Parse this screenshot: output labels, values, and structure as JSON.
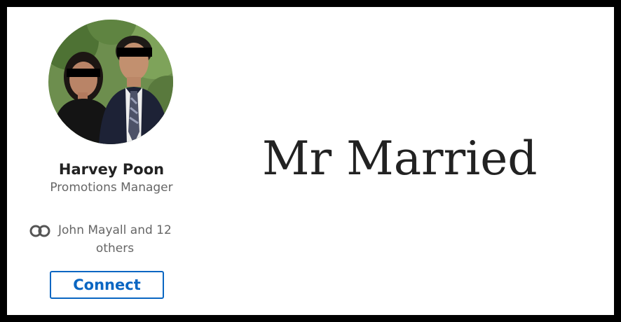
{
  "profile": {
    "name": "Harvey Poon",
    "title": "Promotions Manager",
    "mutual_line1": "John Mayall and 12",
    "mutual_line2": "others",
    "connect_label": "Connect",
    "mutual_icon": "linked-circles-icon"
  },
  "headline": "Mr Married",
  "colors": {
    "accent": "#0a66c2",
    "name_text": "#222222",
    "secondary_text": "#666666",
    "frame": "#000000"
  }
}
